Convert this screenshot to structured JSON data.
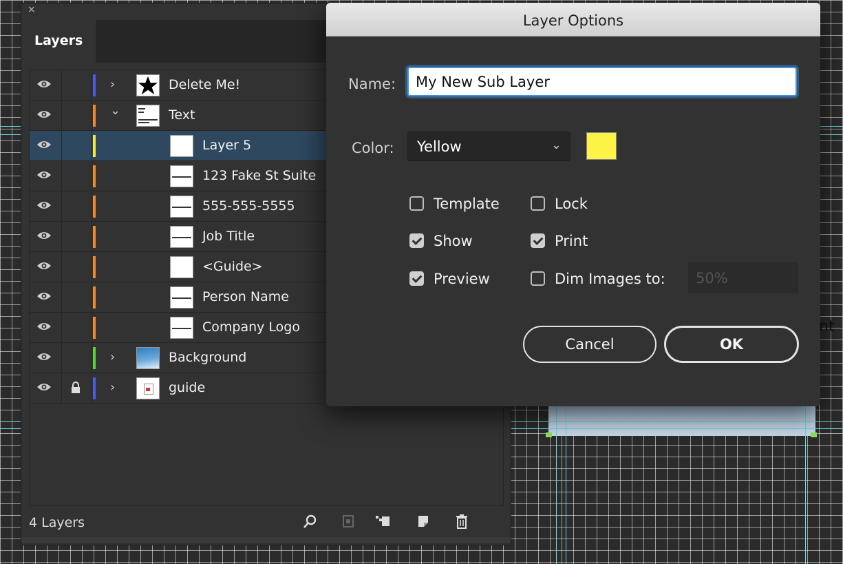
{
  "panel": {
    "close_glyph": "×",
    "tab_label": "Layers",
    "layer_count": "4 Layers",
    "layers": [
      {
        "name": "Delete Me!",
        "color": "#4d5ddf",
        "expand": "›",
        "thumb": "star",
        "locked": false,
        "selected": false,
        "indent": 0
      },
      {
        "name": "Text",
        "color": "#f08a2e",
        "expand": "⌄",
        "thumb": "text",
        "locked": false,
        "selected": false,
        "indent": 0
      },
      {
        "name": "Layer 5",
        "color": "#f5ea3c",
        "expand": "",
        "thumb": "blank",
        "locked": false,
        "selected": true,
        "indent": 1
      },
      {
        "name": "123 Fake St Suite",
        "color": "#f08a2e",
        "expand": "",
        "thumb": "line",
        "locked": false,
        "selected": false,
        "indent": 1
      },
      {
        "name": "555-555-5555",
        "color": "#f08a2e",
        "expand": "",
        "thumb": "line",
        "locked": false,
        "selected": false,
        "indent": 1
      },
      {
        "name": "Job Title",
        "color": "#f08a2e",
        "expand": "",
        "thumb": "jobtitle",
        "locked": false,
        "selected": false,
        "indent": 1
      },
      {
        "name": "<Guide>",
        "color": "#f08a2e",
        "expand": "",
        "thumb": "blank",
        "locked": false,
        "selected": false,
        "indent": 1
      },
      {
        "name": "Person Name",
        "color": "#f08a2e",
        "expand": "",
        "thumb": "line",
        "locked": false,
        "selected": false,
        "indent": 1
      },
      {
        "name": "Company Logo",
        "color": "#f08a2e",
        "expand": "",
        "thumb": "line",
        "locked": false,
        "selected": false,
        "indent": 1
      },
      {
        "name": "Background",
        "color": "#59d53b",
        "expand": "›",
        "thumb": "gradient",
        "locked": false,
        "selected": false,
        "indent": 0
      },
      {
        "name": "guide",
        "color": "#4d5ddf",
        "expand": "›",
        "thumb": "guide",
        "locked": true,
        "selected": false,
        "indent": 0
      }
    ],
    "footer_icons": [
      "search-icon",
      "collect-for-export-icon",
      "make-clipping-mask-icon",
      "new-sublayer-icon",
      "new-layer-icon",
      "trash-icon"
    ]
  },
  "dialog": {
    "title": "Layer Options",
    "name_label": "Name:",
    "name_value": "My New Sub Layer",
    "color_label": "Color:",
    "color_value": "Yellow",
    "swatch_color": "#fdf346",
    "options": {
      "template": {
        "label": "Template",
        "checked": false
      },
      "lock": {
        "label": "Lock",
        "checked": false
      },
      "show": {
        "label": "Show",
        "checked": true
      },
      "print": {
        "label": "Print",
        "checked": true
      },
      "preview": {
        "label": "Preview",
        "checked": true
      },
      "dim_images": {
        "label": "Dim Images to:",
        "checked": false
      }
    },
    "dim_value": "50%",
    "cancel_label": "Cancel",
    "ok_label": "OK"
  },
  "canvas": {
    "partial_text": "nt"
  }
}
